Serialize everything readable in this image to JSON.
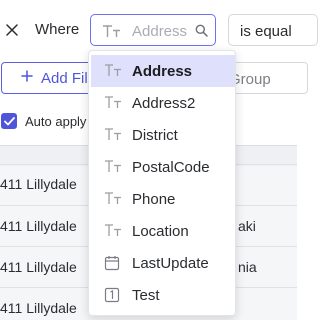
{
  "filter": {
    "where_label": "Where",
    "field_placeholder": "Address",
    "operator_value": "is equal"
  },
  "toolbar": {
    "add_filter_label": "Add Fil",
    "add_group_label": "Group",
    "auto_apply_label": "Auto apply",
    "auto_apply_checked": true
  },
  "grid": {
    "rows": [
      {
        "col1": "411 Lillydale",
        "col2": ""
      },
      {
        "col1": "411 Lillydale",
        "col2": "aki"
      },
      {
        "col1": "411 Lillydale",
        "col2": "nia"
      },
      {
        "col1": "411 Lillydale",
        "col2": ""
      }
    ]
  },
  "dropdown": {
    "selected_index": 0,
    "options": [
      {
        "label": "Address",
        "icon": "text-type-icon"
      },
      {
        "label": "Address2",
        "icon": "text-type-icon"
      },
      {
        "label": "District",
        "icon": "text-type-icon"
      },
      {
        "label": "PostalCode",
        "icon": "text-type-icon"
      },
      {
        "label": "Phone",
        "icon": "text-type-icon"
      },
      {
        "label": "Location",
        "icon": "text-type-icon"
      },
      {
        "label": "LastUpdate",
        "icon": "calendar-icon"
      },
      {
        "label": "Test",
        "icon": "number-type-icon"
      }
    ]
  },
  "colors": {
    "accent": "#4f55d8",
    "selected_bg": "#dfe0fb",
    "focus_border": "#6b72ee"
  }
}
